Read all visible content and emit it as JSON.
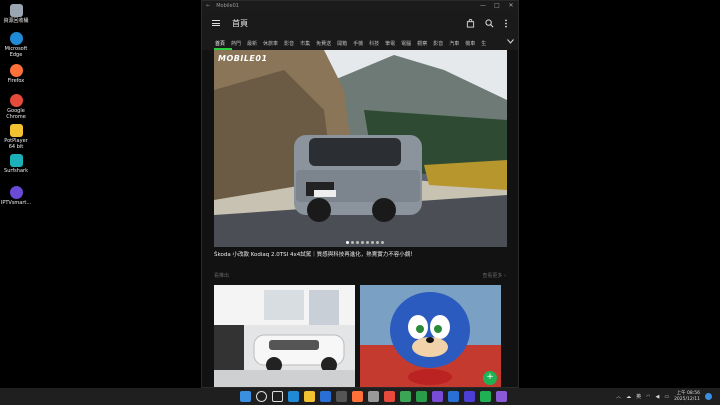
{
  "desktop": {
    "icons": [
      {
        "label": "資源回收桶",
        "color": "#9aa6b2"
      },
      {
        "label": "Microsoft Edge",
        "color": "#1f8ad6"
      },
      {
        "label": "Firefox",
        "color": "#ff7139"
      },
      {
        "label": "Google Chrome",
        "color": "#e64a3b"
      },
      {
        "label": "PotPlayer 64 bit",
        "color": "#f2c230"
      },
      {
        "label": "Surfshark",
        "color": "#1cb1b8"
      },
      {
        "label": "IPTVsmart...",
        "color": "#6a4bd6"
      }
    ]
  },
  "window": {
    "title": "Mobile01",
    "controls": [
      "—",
      "□",
      "✕"
    ]
  },
  "app": {
    "header_title": "首頁",
    "tabs": [
      "首頁",
      "熱門",
      "最新",
      "休旅車",
      "影音",
      "市集",
      "免費送",
      "開箱",
      "手機",
      "科技",
      "筆電",
      "電腦",
      "觀察",
      "影音",
      "汽車",
      "機車",
      "生"
    ],
    "active_tab_index": 0,
    "accent": "#2ecc40",
    "hero": {
      "logo": "MOBILE01",
      "dots": 8,
      "active_dot": 0
    },
    "headline": "Škoda 小改款 Kodiaq 2.0TSI 4x4試駕｜質感與科技再進化，熱賣實力不容小覷！",
    "section": {
      "left_label": "看推出",
      "right_label": "查看更多 ›"
    },
    "fab_label": "+"
  },
  "taskbar": {
    "icons": [
      {
        "name": "windows-start-icon",
        "color": "#3a8fe0"
      },
      {
        "name": "search-icon",
        "color": "#ddd"
      },
      {
        "name": "task-view-icon",
        "color": "#ddd"
      },
      {
        "name": "edge-icon",
        "color": "#1f8ad6"
      },
      {
        "name": "file-explorer-icon",
        "color": "#f2c230"
      },
      {
        "name": "store-icon",
        "color": "#2a6fd6"
      },
      {
        "name": "app-icon-1",
        "color": "#555"
      },
      {
        "name": "firefox-icon",
        "color": "#ff7139"
      },
      {
        "name": "settings-icon",
        "color": "#999"
      },
      {
        "name": "chrome-icon",
        "color": "#e64a3b"
      },
      {
        "name": "app-icon-2",
        "color": "#3aa655"
      },
      {
        "name": "app-icon-3",
        "color": "#2a9d4a"
      },
      {
        "name": "app-icon-4",
        "color": "#7a4bd6"
      },
      {
        "name": "app-icon-5",
        "color": "#2a6fd6"
      },
      {
        "name": "app-icon-6",
        "color": "#4b3fd6"
      },
      {
        "name": "app-icon-7",
        "color": "#1fb255"
      },
      {
        "name": "app-icon-8",
        "color": "#8a5ad6"
      }
    ],
    "tray_lang": "英",
    "time": "上午 08:56",
    "date": "2025/12/11"
  }
}
